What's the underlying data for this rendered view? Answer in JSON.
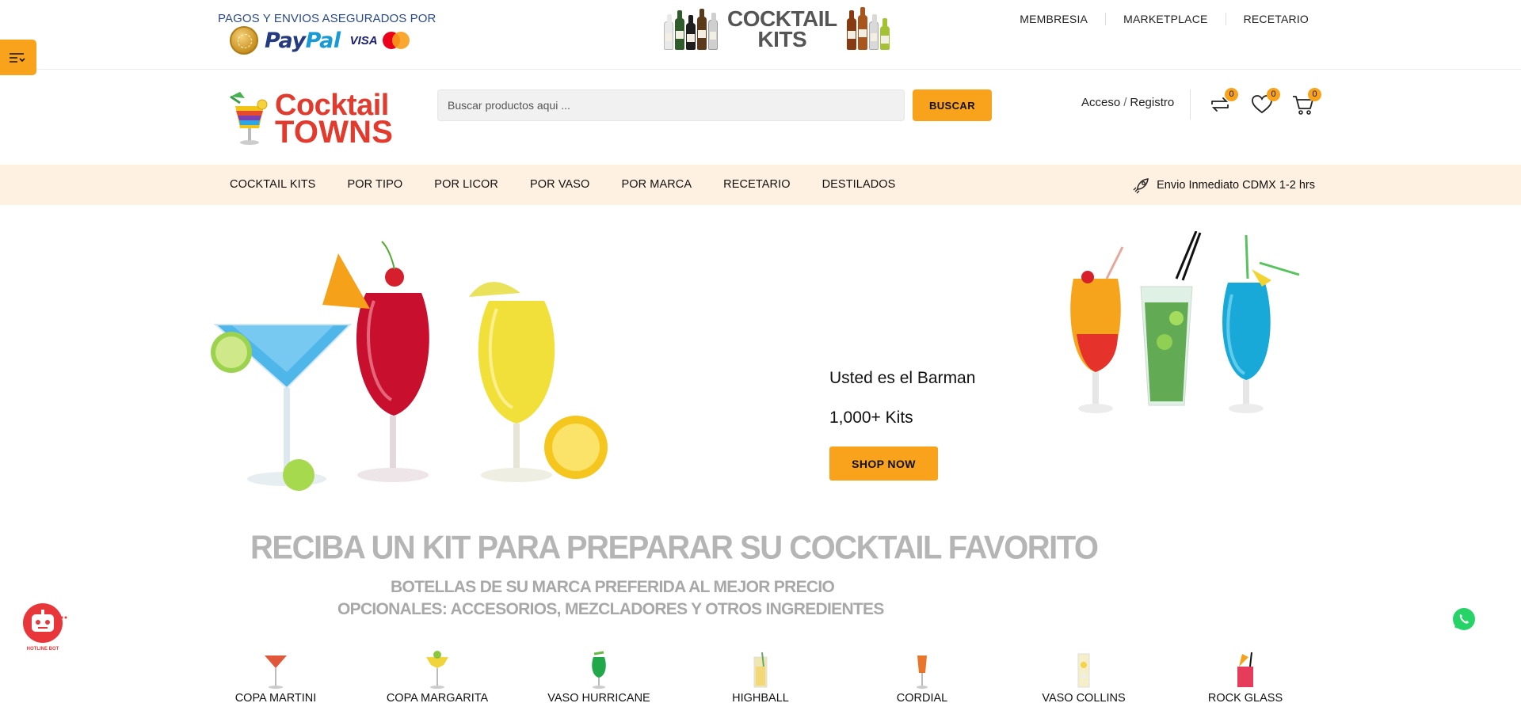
{
  "topbar": {
    "payments_text": "PAGOS Y ENVIOS ASEGURADOS POR",
    "paypal_pay": "Pay",
    "paypal_pal": "Pal",
    "visa": "VISA",
    "kits_banner_line1": "COCKTAIL",
    "kits_banner_line2": "KITS",
    "nav": [
      "MEMBRESIA",
      "MARKETPLACE",
      "RECETARIO"
    ]
  },
  "header": {
    "logo_line1": "Cocktail",
    "logo_line2": "TOWNS",
    "search_placeholder": "Buscar productos aqui ...",
    "search_button": "BUSCAR",
    "login": "Acceso",
    "separator": "/",
    "register": "Registro",
    "compare_count": "0",
    "wishlist_count": "0",
    "cart_count": "0"
  },
  "catnav": {
    "items": [
      "COCKTAIL KITS",
      "POR TIPO",
      "POR LICOR",
      "POR VASO",
      "POR MARCA",
      "RECETARIO",
      "DESTILADOS"
    ],
    "shipping": "Envio Inmediato CDMX 1-2 hrs"
  },
  "hero": {
    "line1": "Usted es el Barman",
    "line2": "1,000+ Kits",
    "button": "SHOP NOW",
    "promo_title": "RECIBA UN KIT PARA PREPARAR SU COCKTAIL FAVORITO",
    "promo_line1": "BOTELLAS DE SU MARCA PREFERIDA AL MEJOR PRECIO",
    "promo_line2": "OPCIONALES:  ACCESORIOS, MEZCLADORES Y OTROS INGREDIENTES"
  },
  "glasses": [
    "COPA MARTINI",
    "COPA MARGARITA",
    "VASO HURRICANE",
    "HIGHBALL",
    "CORDIAL",
    "VASO COLLINS",
    "ROCK GLASS"
  ],
  "bot": {
    "label": "HOTLINE BOT"
  },
  "colors": {
    "accent": "#f9a21c",
    "nav_bg": "#fff1e1",
    "brand_red": "#e23a2c",
    "whatsapp": "#25d366"
  }
}
